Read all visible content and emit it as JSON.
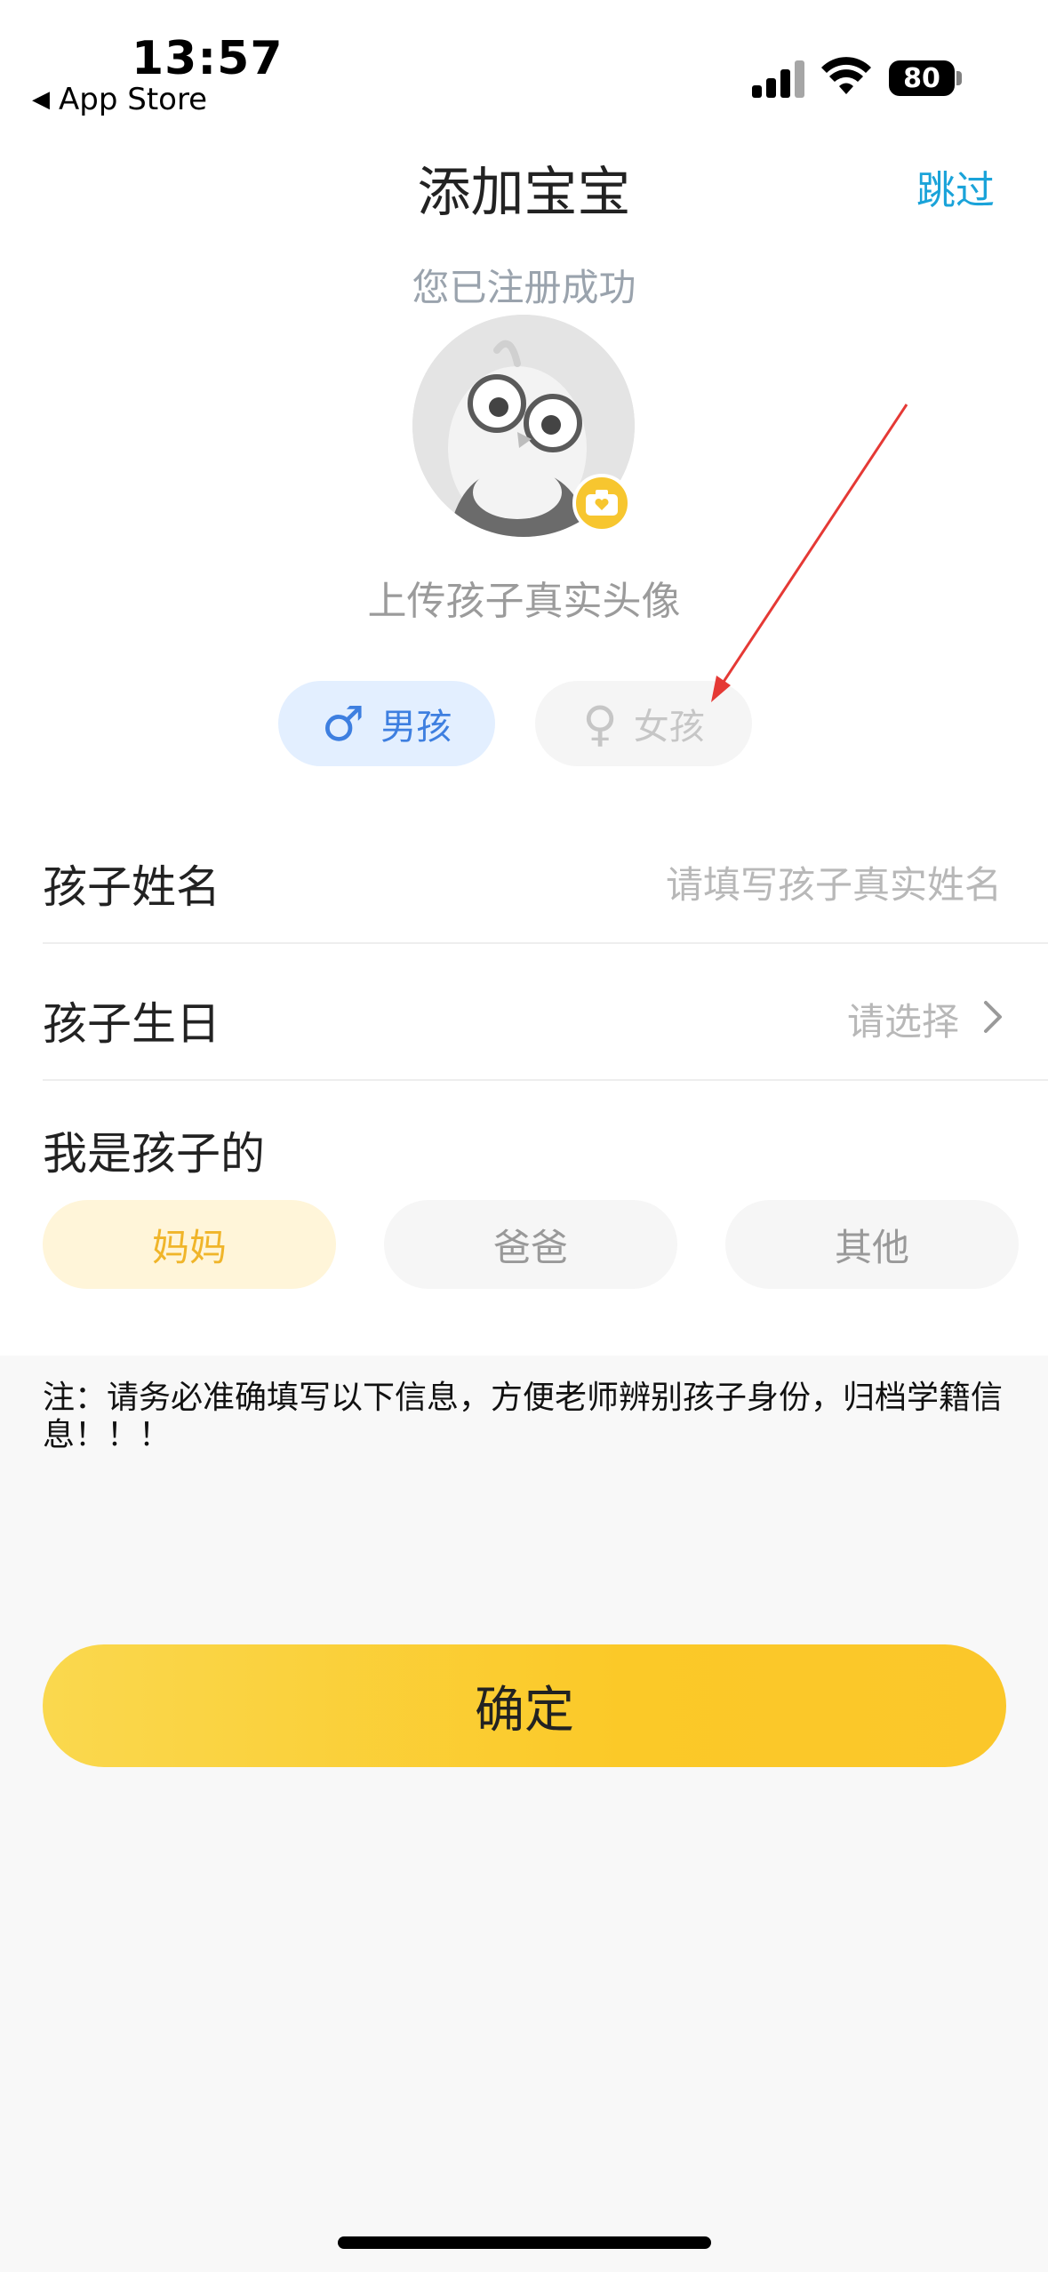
{
  "status_bar": {
    "time": "13:57",
    "back_app": "App Store",
    "back_glyph": "◀",
    "battery": "80",
    "icons": [
      "cellular-signal-icon",
      "wifi-icon",
      "battery-icon"
    ]
  },
  "header": {
    "title": "添加宝宝",
    "skip_label": "跳过",
    "subtitle": "您已注册成功"
  },
  "avatar": {
    "upload_label": "上传孩子真实头像",
    "badge_icon": "camera-icon"
  },
  "gender": {
    "boy": {
      "label": "男孩",
      "glyph": "♂",
      "selected": true
    },
    "girl": {
      "label": "女孩",
      "glyph": "♀",
      "selected": false
    }
  },
  "form": {
    "name": {
      "label": "孩子姓名",
      "placeholder": "请填写孩子真实姓名"
    },
    "birthday": {
      "label": "孩子生日",
      "value": "请选择"
    }
  },
  "relation": {
    "label": "我是孩子的",
    "options": [
      {
        "label": "妈妈",
        "selected": true
      },
      {
        "label": "爸爸",
        "selected": false
      },
      {
        "label": "其他",
        "selected": false
      }
    ]
  },
  "note": "注：请务必准确填写以下信息，方便老师辨别孩子身份，归档学籍信息！！！",
  "confirm_label": "确定",
  "colors": {
    "accent_blue": "#1aa3d9",
    "boy_blue": "#3e7fe0",
    "mom_yellow": "#f0b52a",
    "button_yellow": "#fbc928",
    "annotation_red": "#e53935"
  }
}
